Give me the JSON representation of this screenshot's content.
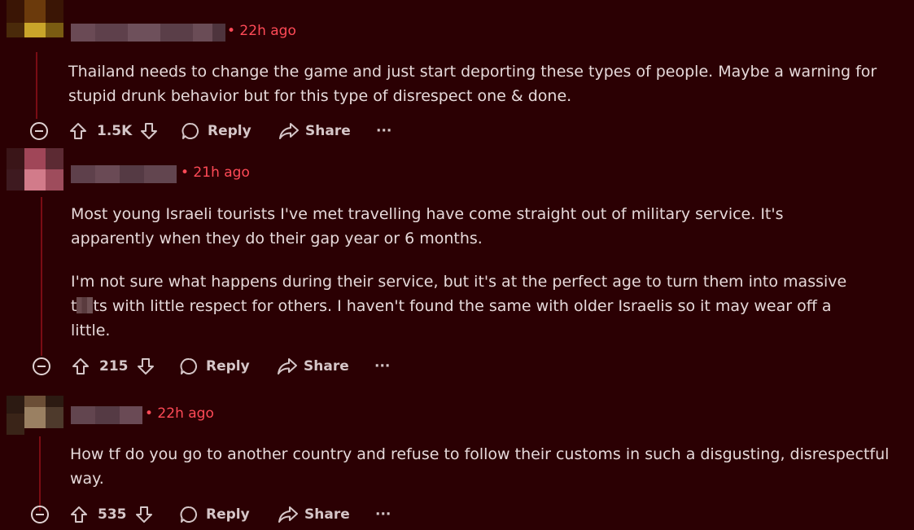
{
  "comments": [
    {
      "timestamp": "• 22h ago",
      "body": [
        "Thailand needs to change the game and just start deporting these types of people. Maybe a warning for",
        "stupid drunk behavior but for this type of disrespect one & done."
      ],
      "votes": "1.5K",
      "reply_label": "Reply",
      "share_label": "Share",
      "more_label": "···"
    },
    {
      "timestamp": "• 21h ago",
      "body_p1": [
        "Most young Israeli tourists I've met travelling have come straight out of military service. It's",
        "apparently when they do their gap year or 6 months."
      ],
      "body_p2_line1": "I'm not sure what happens during their service, but it's at the perfect age to turn them into massive",
      "body_p2_line2_prefix": "t",
      "body_p2_line2_suffix": "ts with little respect for others. I haven't found the same with older Israelis so it may wear off a",
      "body_p2_line3": "little.",
      "votes": "215",
      "reply_label": "Reply",
      "share_label": "Share",
      "more_label": "···"
    },
    {
      "timestamp": "• 22h ago",
      "body": [
        "How tf do you go to another country and refuse to follow their customs in such a disgusting, disrespectful",
        "way."
      ],
      "votes": "535",
      "reply_label": "Reply",
      "share_label": "Share",
      "more_label": "···"
    }
  ],
  "colors": {
    "background": "#2b0003",
    "thread_line": "#7a0c14",
    "timestamp": "#ff4a57",
    "text": "#e6d9da"
  },
  "icons": [
    "collapse-icon",
    "upvote-icon",
    "downvote-icon",
    "reply-icon",
    "share-icon",
    "more-icon"
  ]
}
